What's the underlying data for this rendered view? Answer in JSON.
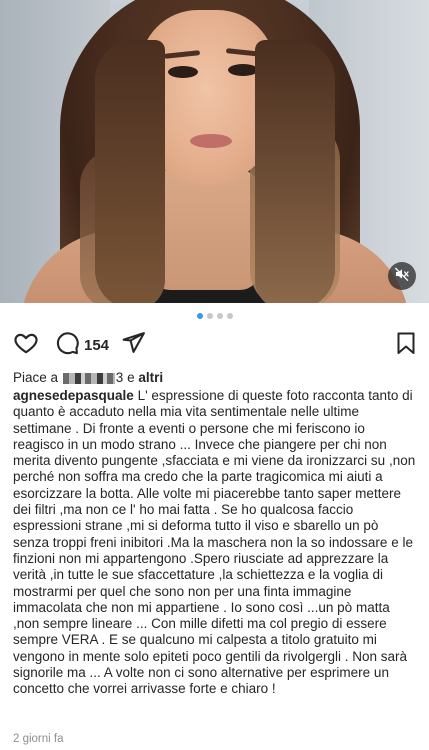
{
  "post": {
    "comment_count": "154",
    "likes_prefix": "Piace a",
    "likes_user_fragment": "3",
    "likes_suffix": "e",
    "likes_others": "altri",
    "username": "agnesedepasquale",
    "caption": "L' espressione di queste foto racconta tanto di quanto è accaduto nella mia vita sentimentale nelle ultime settimane . Di fronte a eventi o persone che mi feriscono  io reagisco in un modo strano ... Invece che piangere per chi non merita divento pungente ,sfacciata e mi viene da ironizzarci su ,non perché non soffra ma credo che la parte tragicomica mi aiuti a esorcizzare la botta. Alle volte mi piacerebbe tanto saper mettere dei filtri ,ma non ce l' ho mai fatta . Se ho qualcosa faccio espressioni strane ,mi si deforma tutto il viso e sbarello un pò senza troppi freni inibitori .Ma la maschera non la so indossare e le finzioni non mi appartengono .Spero riusciate ad apprezzare la verità ,in tutte le sue sfaccettature ,la schiettezza e la voglia di mostrarmi per quel che sono non per una finta immagine immacolata che non mi appartiene . Io sono così ...un pò matta ,non sempre lineare ... Con mille difetti ma col pregio di essere sempre VERA . E se qualcuno mi calpesta a titolo gratuito mi vengono in mente solo epiteti poco gentili da rivolgergli . Non sarà signorile ma ... A volte non ci sono alternative per esprimere un concetto che vorrei arrivasse forte e chiaro !",
    "timestamp": "2 giorni fa"
  },
  "carousel": {
    "total": 4,
    "active_index": 0
  },
  "icons": {
    "like": "heart-outline-icon",
    "comment": "comment-bubble-icon",
    "share": "paper-plane-icon",
    "save": "bookmark-icon",
    "mute": "speaker-muted-icon"
  },
  "colors": {
    "accent": "#3897f0",
    "text": "#262626",
    "muted": "#8e8e8e"
  }
}
